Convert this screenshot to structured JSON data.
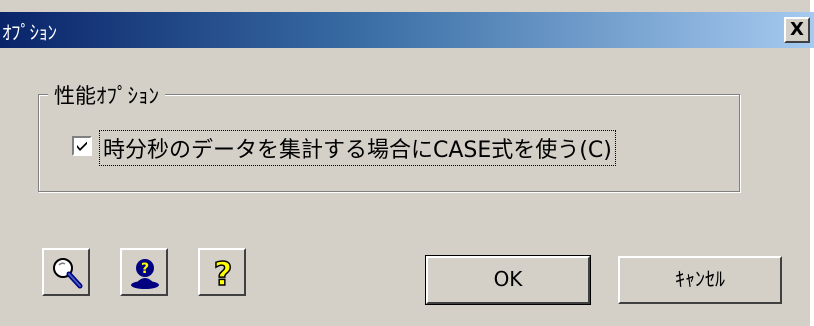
{
  "window": {
    "title": "ｵﾌﾟｼｮﾝ",
    "close_label": "X"
  },
  "group": {
    "legend": "性能ｵﾌﾟｼｮﾝ",
    "option": {
      "label": "時分秒のデータを集計する場合にCASE式を使う(C)",
      "checked": true
    }
  },
  "toolbar": {
    "icons": [
      "magnifier-icon",
      "person-help-icon",
      "question-mark-icon"
    ]
  },
  "buttons": {
    "ok_label": "OK",
    "cancel_label": "ｷｬﾝｾﾙ"
  },
  "colors": {
    "titlebar_start": "#0a246a",
    "titlebar_end": "#a6caf0",
    "face": "#d4d0c8"
  }
}
